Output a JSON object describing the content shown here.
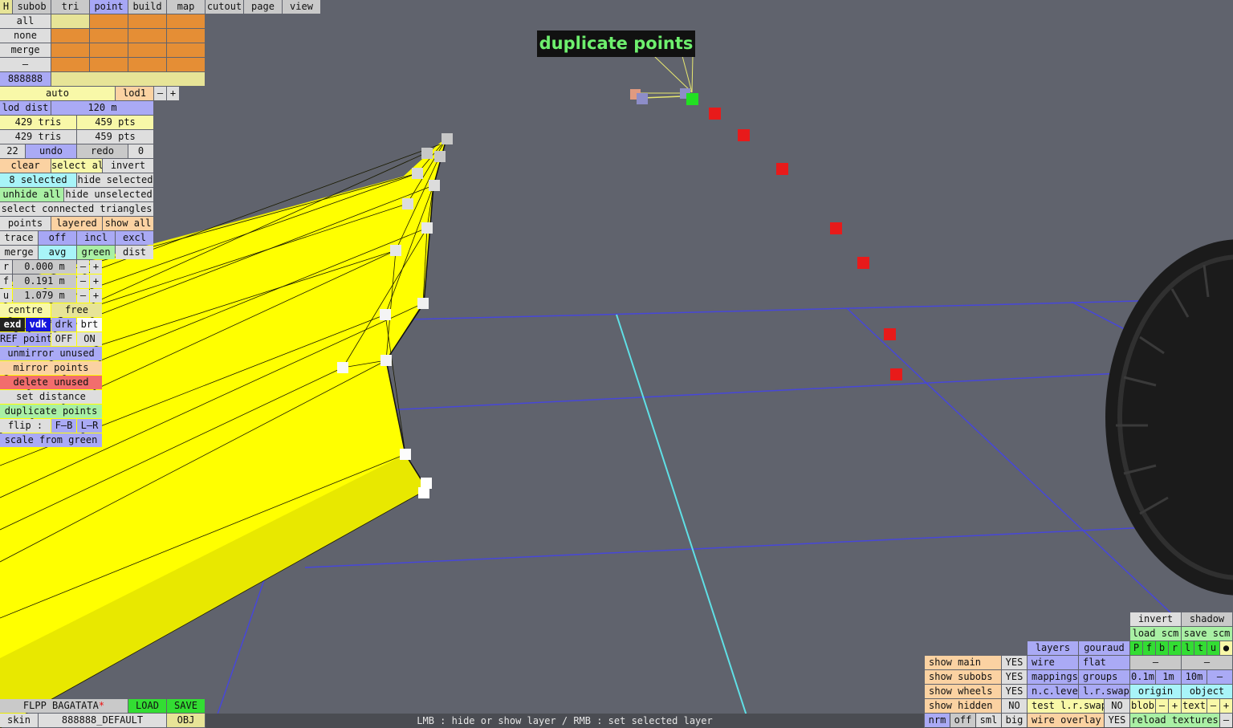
{
  "tooltip": "duplicate points",
  "status_hint": "LMB : hide or show layer / RMB : set selected layer",
  "top_tabs": {
    "h": "H",
    "subob": "subob",
    "tri": "tri",
    "point": "point",
    "build": "build",
    "map": "map",
    "cutout": "cutout",
    "page": "page",
    "view": "view"
  },
  "sel_rows": {
    "all": "all",
    "none": "none",
    "merge": "merge",
    "dash": "–",
    "color_code": "888888"
  },
  "lod": {
    "auto": "auto",
    "lod1": "lod1",
    "minus": "–",
    "plus": "+",
    "dist_label": "lod dist",
    "dist_value": "120 m"
  },
  "stats": {
    "tris1": "429 tris",
    "pts1": "459 pts",
    "tris2": "429 tris",
    "pts2": "459 pts"
  },
  "history": {
    "count": "22",
    "undo": "undo",
    "redo": "redo",
    "redo_count": "0"
  },
  "selection": {
    "clear": "clear",
    "select_all": "select all",
    "invert": "invert",
    "selected": "8 selected",
    "hide_selected": "hide selected",
    "unhide_all": "unhide all",
    "hide_unselected": "hide unselected",
    "select_connected": "select connected triangles"
  },
  "display": {
    "points": "points",
    "layered": "layered",
    "show_all": "show all",
    "trace": "trace",
    "off": "off",
    "incl": "incl",
    "excl": "excl",
    "merge": "merge",
    "avg": "avg",
    "green": "green",
    "dist": "dist"
  },
  "coords": {
    "r_label": "r",
    "r_value": "0.000 m",
    "f_label": "f",
    "f_value": "0.191 m",
    "u_label": "u",
    "u_value": "1.079 m",
    "minus": "–",
    "plus": "+"
  },
  "pivot": {
    "centre": "centre",
    "free": "free"
  },
  "shade": {
    "exd": "exd",
    "vdk": "vdk",
    "drk": "drk",
    "brt": "brt"
  },
  "ref": {
    "label": "REF points",
    "off": "OFF",
    "on": "ON"
  },
  "actions": {
    "unmirror": "unmirror unused",
    "mirror": "mirror points",
    "delete_unused": "delete unused",
    "set_distance": "set distance",
    "duplicate": "duplicate points",
    "flip": "flip :",
    "fb": "F–B",
    "lr": "L–R",
    "scale_green": "scale from green"
  },
  "file": {
    "name": "FLPP BAGATATA",
    "modified_mark": "*",
    "load": "LOAD",
    "save": "SAVE",
    "skin_label": "skin",
    "skin_value": "888888_DEFAULT",
    "obj": "OBJ"
  },
  "right_panel": {
    "invert": "invert",
    "shadow": "shadow",
    "load_scm": "load scm",
    "save_scm": "save scm",
    "layers": "layers",
    "gouraud": "gouraud",
    "view_letters": [
      "P",
      "f",
      "b",
      "r",
      "l",
      "t",
      "u"
    ],
    "dot": "●",
    "show_main": "show main",
    "show_main_val": "YES",
    "wire": "wire",
    "flat": "flat",
    "dash1": "–",
    "dash2": "–",
    "show_subobs": "show subobs",
    "show_subobs_val": "YES",
    "mappings": "mappings",
    "groups": "groups",
    "g01": "0.1m",
    "g1": "1m",
    "g10": "10m",
    "gminus": "–",
    "show_wheels": "show wheels",
    "show_wheels_val": "YES",
    "nclevel": "n.c.level",
    "lrswap": "l.r.swap",
    "origin": "origin",
    "object": "object",
    "show_hidden": "show hidden",
    "show_hidden_val": "NO",
    "test_lr": "test l.r.swap",
    "test_lr_val": "NO",
    "blob": "blob",
    "text": "text",
    "nrm": "nrm",
    "off": "off",
    "sml": "sml",
    "big": "big",
    "wire_overlay": "wire overlay",
    "wire_overlay_val": "YES",
    "reload": "reload textures"
  }
}
